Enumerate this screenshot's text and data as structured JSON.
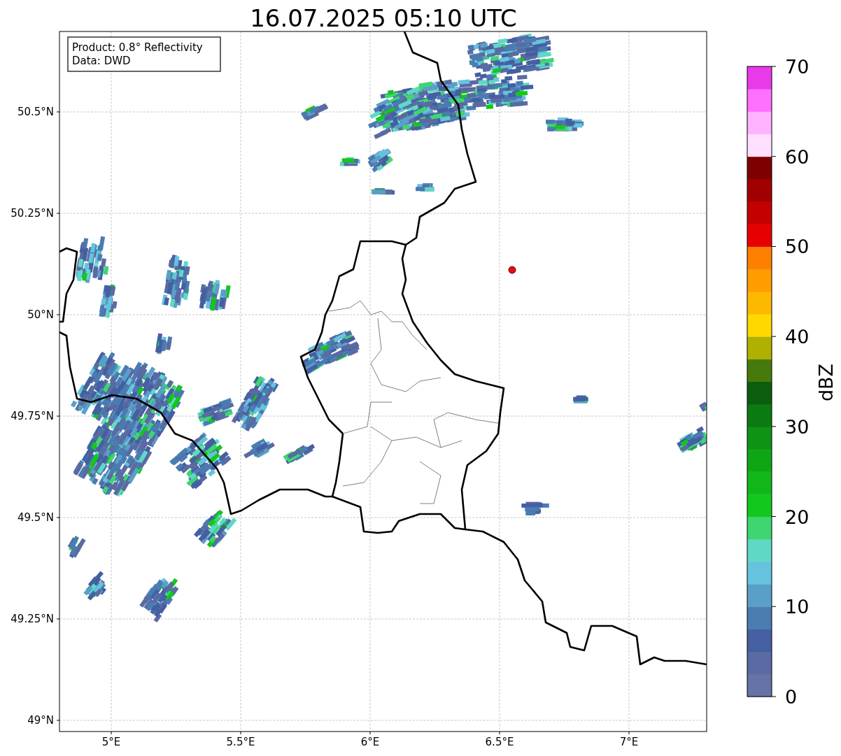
{
  "title": "16.07.2025 05:10 UTC",
  "info_box": [
    "Product: 0.8° Reflectivity",
    "Data: DWD"
  ],
  "map": {
    "xticks": [
      "5°E",
      "5.5°E",
      "6°E",
      "6.5°E",
      "7°E"
    ],
    "yticks": [
      "50.5°N",
      "50.25°N",
      "50°N",
      "49.75°N",
      "49.5°N",
      "49.25°N",
      "49°N"
    ]
  },
  "colorbar": {
    "label": "dBZ",
    "ticks": [
      "70",
      "60",
      "50",
      "40",
      "30",
      "20",
      "10",
      "0"
    ],
    "bins": [
      {
        "color": "#6673a6"
      },
      {
        "color": "#5a6aa2"
      },
      {
        "color": "#445fa2"
      },
      {
        "color": "#4a7cb2"
      },
      {
        "color": "#5a9fc8"
      },
      {
        "color": "#66c3de"
      },
      {
        "color": "#60d8c6"
      },
      {
        "color": "#3ed670"
      },
      {
        "color": "#12c81c"
      },
      {
        "color": "#11b719"
      },
      {
        "color": "#0fa616"
      },
      {
        "color": "#0e9314"
      },
      {
        "color": "#0b7a10"
      },
      {
        "color": "#0a5e0d"
      },
      {
        "color": "#467a0c"
      },
      {
        "color": "#b0b000"
      },
      {
        "color": "#ffd800"
      },
      {
        "color": "#ffb800"
      },
      {
        "color": "#ff9c00"
      },
      {
        "color": "#ff8000"
      },
      {
        "color": "#e60000"
      },
      {
        "color": "#c40000"
      },
      {
        "color": "#a20000"
      },
      {
        "color": "#7e0000"
      },
      {
        "color": "#ffe0ff"
      },
      {
        "color": "#ffb2ff"
      },
      {
        "color": "#ff70ff"
      },
      {
        "color": "#e83ae8"
      }
    ]
  }
}
